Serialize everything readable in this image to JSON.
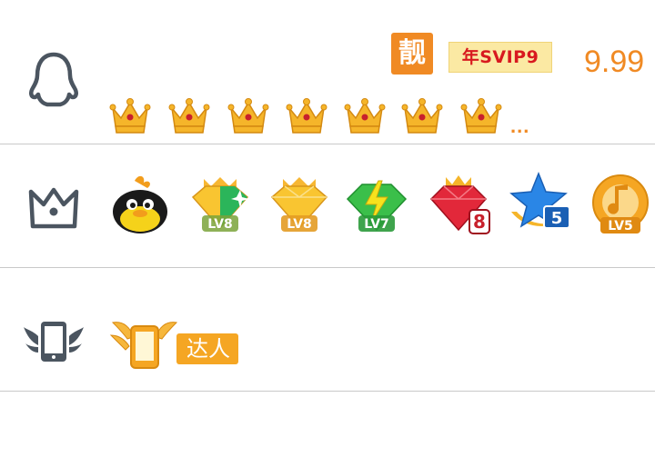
{
  "rows": {
    "qq": {
      "icon": "penguin-outline-icon",
      "pretty_badge": "靓",
      "svip_badge": "年SVIP9",
      "price": "9.99",
      "crown_icons": [
        "crown-icon",
        "crown-icon",
        "crown-icon",
        "crown-icon",
        "crown-icon",
        "crown-icon",
        "crown-icon"
      ],
      "more": "..."
    },
    "vip": {
      "icon": "crown-outline-icon",
      "badges": [
        {
          "name": "penguin-badge-icon",
          "label": ""
        },
        {
          "name": "diamond-badge-icon",
          "label": "LV8"
        },
        {
          "name": "gold-diamond-badge-icon",
          "label": "LV8"
        },
        {
          "name": "green-lightning-badge-icon",
          "label": "LV7"
        },
        {
          "name": "red-gem-badge-icon",
          "label": "8"
        },
        {
          "name": "blue-star-badge-icon",
          "label": "5"
        },
        {
          "name": "music-badge-icon",
          "label": "LV5"
        }
      ]
    },
    "mobile": {
      "icon": "winged-phone-icon",
      "expert_badge_label": "达人"
    }
  },
  "colors": {
    "accent": "#f08a24",
    "icon_gray": "#4b5560",
    "divider": "#c9c9c9",
    "svip_bg": "#fbe9a3",
    "svip_text": "#d8191f"
  }
}
